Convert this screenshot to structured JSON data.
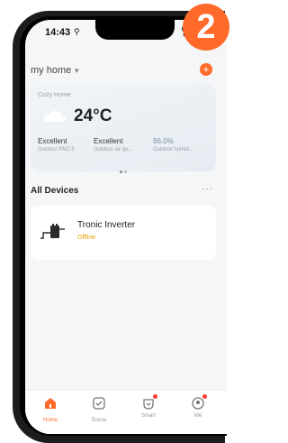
{
  "status_bar": {
    "time": "14:43",
    "location_glyph": "⚲",
    "signal": "▮▮▮",
    "wifi": "ᯤ"
  },
  "home": {
    "name": "my home",
    "add_symbol": "+"
  },
  "badge": "2",
  "weather": {
    "place": "Cozy Home",
    "temperature": "24°C",
    "stats": [
      {
        "value": "Excellent",
        "label": "Outdoor PM2.5"
      },
      {
        "value": "Excellent",
        "label": "Outdoor air qu..."
      },
      {
        "value": "86.0%",
        "label": "Outdoor humid..."
      }
    ]
  },
  "devices_section": {
    "title": "All Devices",
    "more": "···"
  },
  "devices": [
    {
      "name": "Tronic Inverter",
      "status": "Offline"
    }
  ],
  "tabs": [
    {
      "label": "Home",
      "icon": "home-icon",
      "active": true
    },
    {
      "label": "Scene",
      "icon": "scene-icon",
      "active": false
    },
    {
      "label": "Smart",
      "icon": "smart-icon",
      "active": false
    },
    {
      "label": "Me",
      "icon": "me-icon",
      "active": false
    }
  ],
  "colors": {
    "accent": "#ff6a2b",
    "offline": "#e6a100"
  }
}
